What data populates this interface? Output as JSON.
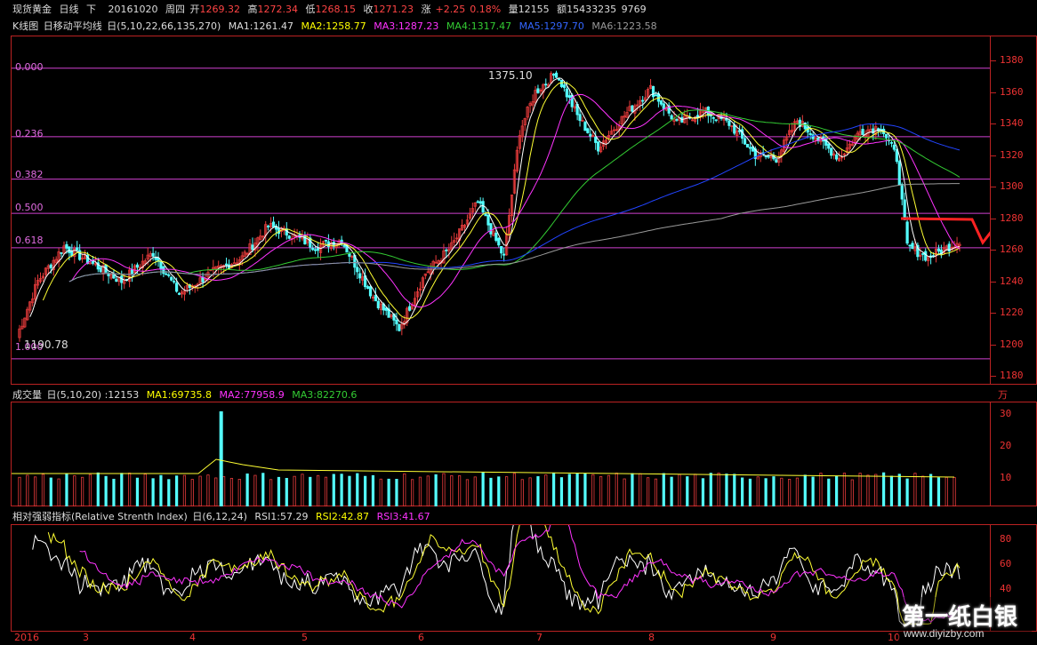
{
  "header": {
    "instrument": "现货黄金",
    "period": "日线",
    "direction": "下",
    "date": "20161020",
    "weekday": "周四",
    "open_label": "开",
    "open": "1269.32",
    "high_label": "高",
    "high": "1272.34",
    "low_label": "低",
    "low": "1268.15",
    "close_label": "收",
    "close": "1271.23",
    "change_label": "涨",
    "change": "+2.25",
    "change_pct": "0.18%",
    "volume_label": "量",
    "volume": "12155",
    "amount_label": "额",
    "amount": "15433235",
    "extra": "9769"
  },
  "ma_legend": {
    "title": "K线图",
    "desc": "日移动平均线",
    "params": "日(5,10,22,66,135,270)",
    "ma1": "MA1:1261.47",
    "ma2": "MA2:1258.77",
    "ma3": "MA3:1287.23",
    "ma4": "MA4:1317.47",
    "ma5": "MA5:1297.70",
    "ma6": "MA6:1223.58"
  },
  "price_axis": {
    "ticks": [
      "1380",
      "1360",
      "1340",
      "1320",
      "1300",
      "1280",
      "1260",
      "1240",
      "1220",
      "1200",
      "1180"
    ]
  },
  "fib_levels": [
    "0.000",
    "0.236",
    "0.382",
    "0.500",
    "0.618",
    "1.000"
  ],
  "annotations": {
    "peak": "1375.10",
    "trough": "1190.78"
  },
  "volume_panel": {
    "title": "成交量",
    "params": "日(5,10,20)",
    "value": ":12153",
    "ma1": "MA1:69735.8",
    "ma2": "MA2:77958.9",
    "ma3": "MA3:82270.6",
    "unit": "万",
    "ticks": [
      "30",
      "20",
      "10"
    ]
  },
  "rsi_panel": {
    "title": "相对强弱指标(Relative Strenth Index)",
    "params": "日(6,12,24)",
    "rsi1": "RSI1:57.29",
    "rsi2": "RSI2:42.87",
    "rsi3": "RSI3:41.67",
    "ticks": [
      "80",
      "60",
      "40"
    ]
  },
  "x_axis": {
    "labels": [
      "2016",
      "3",
      "4",
      "5",
      "6",
      "7",
      "8",
      "9",
      "10"
    ]
  },
  "watermark": {
    "title": "第一纸白银",
    "url": "www.diyizby.com"
  },
  "colors": {
    "up": "#e63b3b",
    "down": "#54ffff",
    "grid": "#b22222",
    "fib": "#d040d0",
    "ma1": "#ffffff",
    "ma2": "#ffff33",
    "ma3": "#ff33ff",
    "ma4": "#33cc33",
    "ma5": "#2244ff",
    "ma6": "#999999",
    "arrow": "#ff2222"
  }
}
